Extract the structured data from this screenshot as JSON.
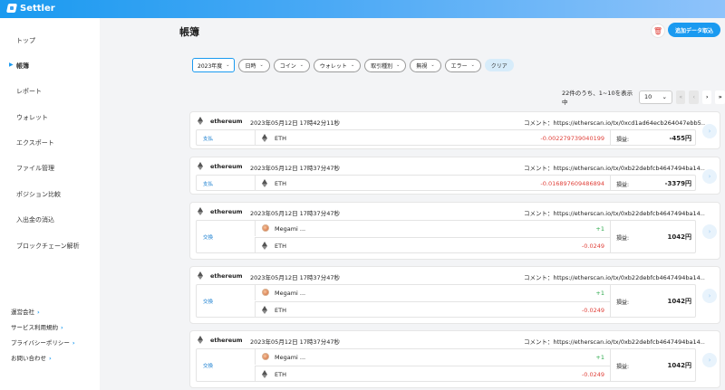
{
  "app": {
    "name": "Settler",
    "accent": "#1a9af0",
    "negative_color": "#e0413a",
    "positive_color": "#2aa84a"
  },
  "sidebar": {
    "items": [
      {
        "label": "トップ",
        "active": false
      },
      {
        "label": "帳簿",
        "active": true
      },
      {
        "label": "レポート",
        "active": false
      },
      {
        "label": "ウォレット",
        "active": false
      },
      {
        "label": "エクスポート",
        "active": false
      },
      {
        "label": "ファイル管理",
        "active": false
      },
      {
        "label": "ポジション比較",
        "active": false
      },
      {
        "label": "入出金の消込",
        "active": false
      },
      {
        "label": "ブロックチェーン解析",
        "active": false
      }
    ],
    "footer_links": [
      "運営会社",
      "サービス利用規約",
      "プライバシーポリシー",
      "お問い合わせ"
    ]
  },
  "header": {
    "title": "帳簿",
    "add_button": "追加データ取込",
    "trash_icon": "trash-icon"
  },
  "filters": {
    "year": "2023年度",
    "buttons": [
      "日時",
      "コイン",
      "ウォレット",
      "取引種別",
      "無視",
      "エラー"
    ],
    "clear": "クリア"
  },
  "pagination": {
    "summary": "22件のうち、1~10を表示中",
    "per_page": "10",
    "first": "«",
    "prev": "‹",
    "next": "›",
    "last": "»"
  },
  "transactions": [
    {
      "chain": "ethereum",
      "datetime": "2023年05月12日 17時42分11秒",
      "comment_label": "コメント：",
      "comment": "https://etherscan.io/tx/0xcd1ad64ecb264047ebb5…",
      "type": "支払",
      "rows": [
        {
          "token": "ETH",
          "icon": "eth-icon",
          "amount": "-0.002279739040199",
          "positive": false
        }
      ],
      "pl_label": "損益:",
      "pl_value": "-455円"
    },
    {
      "chain": "ethereum",
      "datetime": "2023年05月12日 17時37分47秒",
      "comment_label": "コメント：",
      "comment": "https://etherscan.io/tx/0xb22debfcb4647494ba14…",
      "type": "支払",
      "rows": [
        {
          "token": "ETH",
          "icon": "eth-icon",
          "amount": "-0.016897609486894",
          "positive": false
        }
      ],
      "pl_label": "損益:",
      "pl_value": "-3379円"
    },
    {
      "chain": "ethereum",
      "datetime": "2023年05月12日 17時37分47秒",
      "comment_label": "コメント：",
      "comment": "https://etherscan.io/tx/0xb22debfcb4647494ba14…",
      "type": "交換",
      "rows": [
        {
          "token": "Megami ...",
          "icon": "nft-icon",
          "amount": "+1",
          "positive": true
        },
        {
          "token": "ETH",
          "icon": "eth-icon",
          "amount": "-0.0249",
          "positive": false
        }
      ],
      "pl_label": "損益:",
      "pl_value": "1042円"
    },
    {
      "chain": "ethereum",
      "datetime": "2023年05月12日 17時37分47秒",
      "comment_label": "コメント：",
      "comment": "https://etherscan.io/tx/0xb22debfcb4647494ba14…",
      "type": "交換",
      "rows": [
        {
          "token": "Megami ...",
          "icon": "nft-icon",
          "amount": "+1",
          "positive": true
        },
        {
          "token": "ETH",
          "icon": "eth-icon",
          "amount": "-0.0249",
          "positive": false
        }
      ],
      "pl_label": "損益:",
      "pl_value": "1042円"
    },
    {
      "chain": "ethereum",
      "datetime": "2023年05月12日 17時37分47秒",
      "comment_label": "コメント：",
      "comment": "https://etherscan.io/tx/0xb22debfcb4647494ba14…",
      "type": "交換",
      "rows": [
        {
          "token": "Megami ...",
          "icon": "nft-icon",
          "amount": "+1",
          "positive": true
        },
        {
          "token": "ETH",
          "icon": "eth-icon",
          "amount": "-0.0249",
          "positive": false
        }
      ],
      "pl_label": "損益:",
      "pl_value": "1042円"
    }
  ]
}
